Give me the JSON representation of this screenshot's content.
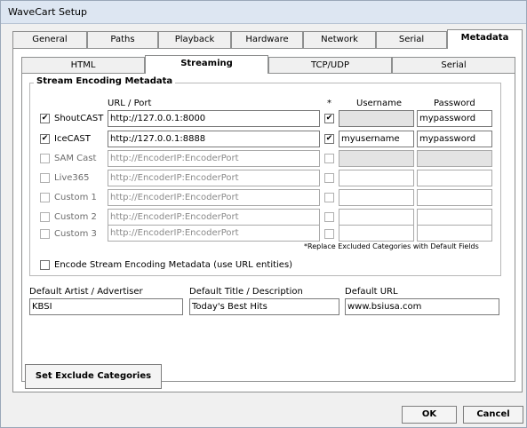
{
  "window": {
    "title": "WaveCart Setup"
  },
  "main_tabs": [
    {
      "label": "General"
    },
    {
      "label": "Paths"
    },
    {
      "label": "Playback"
    },
    {
      "label": "Hardware"
    },
    {
      "label": "Network"
    },
    {
      "label": "Serial"
    },
    {
      "label": "Metadata"
    }
  ],
  "sub_tabs": [
    {
      "label": "HTML"
    },
    {
      "label": "Streaming"
    },
    {
      "label": "TCP/UDP"
    },
    {
      "label": "Serial"
    }
  ],
  "group": {
    "title": "Stream Encoding Metadata",
    "col_url": "URL / Port",
    "col_star": "*",
    "col_username": "Username",
    "col_password": "Password"
  },
  "rows": [
    {
      "label": "ShoutCAST",
      "checked": "✔",
      "url": "http://127.0.0.1:8000",
      "star_checked": "✔",
      "username": "",
      "password": "mypassword"
    },
    {
      "label": "IceCAST",
      "checked": "✔",
      "url": "http://127.0.0.1:8888",
      "star_checked": "✔",
      "username": "myusername",
      "password": "mypassword"
    },
    {
      "label": "SAM Cast",
      "checked": "",
      "url": "http://EncoderIP:EncoderPort",
      "star_checked": "",
      "username": "",
      "password": ""
    },
    {
      "label": "Live365",
      "checked": "",
      "url": "http://EncoderIP:EncoderPort",
      "star_checked": "",
      "username": "",
      "password": ""
    },
    {
      "label": "Custom 1",
      "checked": "",
      "url": "http://EncoderIP:EncoderPort",
      "star_checked": "",
      "username": "",
      "password": ""
    },
    {
      "label": "Custom 2",
      "checked": "",
      "url": "http://EncoderIP:EncoderPort",
      "star_checked": "",
      "username": "",
      "password": ""
    },
    {
      "label": "Custom 3",
      "checked": "",
      "url": "http://EncoderIP:EncoderPort",
      "star_checked": "",
      "username": "",
      "password": ""
    }
  ],
  "replace_note": "*Replace Excluded Categories with Default Fields",
  "encode_option": {
    "label": "Encode Stream Encoding Metadata (use URL entities)",
    "checked": ""
  },
  "defaults": {
    "artist_label": "Default Artist / Advertiser",
    "artist_value": "KBSI",
    "title_label": "Default Title / Description",
    "title_value": "Today's Best Hits",
    "url_label": "Default URL",
    "url_value": "www.bsiusa.com"
  },
  "buttons": {
    "exclude": "Set Exclude Categories",
    "ok": "OK",
    "cancel": "Cancel"
  }
}
